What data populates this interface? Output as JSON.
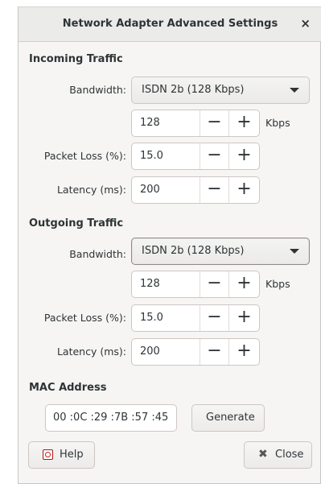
{
  "window": {
    "title": "Network Adapter Advanced Settings",
    "close_symbol": "×"
  },
  "incoming": {
    "heading": "Incoming Traffic",
    "bandwidth_label": "Bandwidth:",
    "bandwidth_value": "ISDN 2b (128 Kbps)",
    "kbps_value": "128",
    "kbps_unit": "Kbps",
    "packet_loss_label": "Packet Loss (%):",
    "packet_loss_value": "15.0",
    "latency_label": "Latency (ms):",
    "latency_value": "200"
  },
  "outgoing": {
    "heading": "Outgoing Traffic",
    "bandwidth_label": "Bandwidth:",
    "bandwidth_value": "ISDN 2b (128 Kbps)",
    "kbps_value": "128",
    "kbps_unit": "Kbps",
    "packet_loss_label": "Packet Loss (%):",
    "packet_loss_value": "15.0",
    "latency_label": "Latency (ms):",
    "latency_value": "200"
  },
  "spin": {
    "minus": "−",
    "plus": "+"
  },
  "mac": {
    "heading": "MAC Address",
    "value": "00 :0C :29 :7B :57 :45",
    "generate_label": "Generate"
  },
  "footer": {
    "help_label": "Help",
    "close_label": "Close",
    "close_glyph": "✖"
  }
}
